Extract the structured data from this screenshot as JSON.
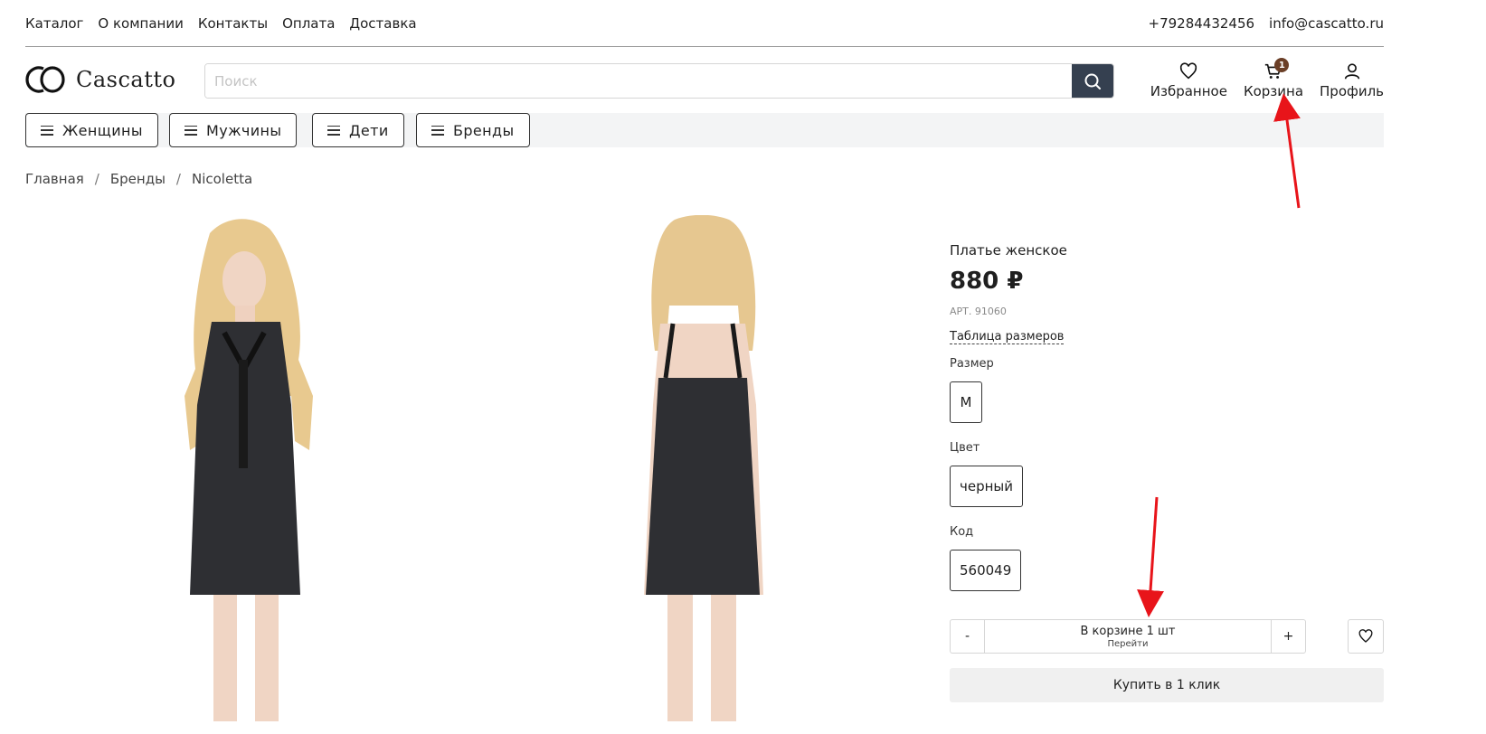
{
  "topnav": [
    "Каталог",
    "О компании",
    "Контакты",
    "Оплата",
    "Доставка"
  ],
  "contacts": {
    "phone": "+79284432456",
    "email": "info@cascatto.ru"
  },
  "logo": {
    "text": "Cascatto",
    "mark": "CO"
  },
  "search": {
    "placeholder": "Поиск"
  },
  "header_icons": {
    "favorites": "Избранное",
    "cart": "Корзина",
    "cart_count": "1",
    "profile": "Профиль"
  },
  "categories": [
    "Женщины",
    "Мужчины",
    "Дети",
    "Бренды"
  ],
  "breadcrumb": [
    "Главная",
    "Бренды",
    "Nicoletta"
  ],
  "breadcrumb_sep": "/",
  "product": {
    "title": "Платье женское",
    "price": "880 ₽",
    "article": "АРТ. 91060",
    "size_table": "Таблица размеров",
    "size_label": "Размер",
    "size_value": "M",
    "color_label": "Цвет",
    "color_value": "черный",
    "code_label": "Код",
    "code_value": "560049"
  },
  "cart": {
    "minus": "-",
    "plus": "+",
    "in_cart": "В корзине 1 шт",
    "go": "Перейти"
  },
  "buy_one_click": "Купить в 1 клик",
  "colors": {
    "search_button": "#354050",
    "badge": "#6b3f27",
    "annotation": "#e8141a"
  }
}
